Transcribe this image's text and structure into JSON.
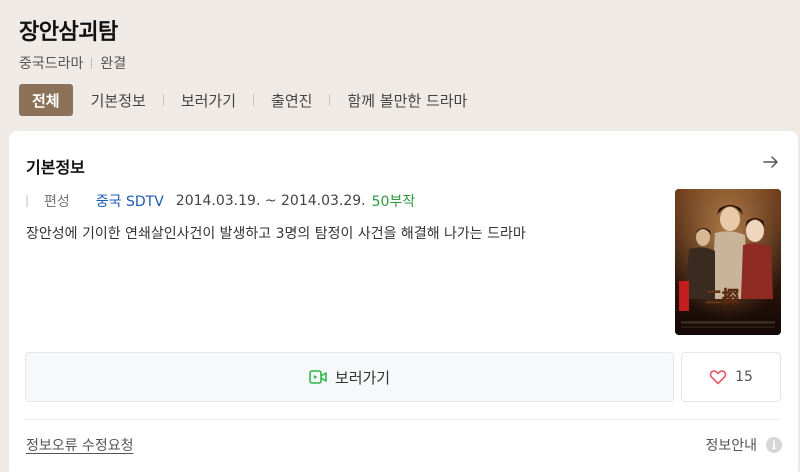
{
  "header": {
    "title": "장안삼괴탐",
    "category": "중국드라마",
    "status": "완결",
    "tabs": [
      {
        "label": "전체",
        "active": true
      },
      {
        "label": "기본정보",
        "active": false
      },
      {
        "label": "보러가기",
        "active": false
      },
      {
        "label": "출연진",
        "active": false
      },
      {
        "label": "함께 볼만한 드라마",
        "active": false
      }
    ]
  },
  "card": {
    "title": "기본정보",
    "arrow_icon": "chevron-right-icon",
    "info": {
      "label": "편성",
      "channel": "중국 SDTV",
      "dates": "2014.03.19. ~ 2014.03.29.",
      "episodes": "50부작"
    },
    "description": "장안성에 기이한 연쇄살인사건이 발생하고 3명의 탐정이 사건을 해결해 나가는 드라마",
    "poster_icon": "drama-poster-image",
    "watch_button": {
      "label": "보러가기",
      "icon": "play-video-icon"
    },
    "like_button": {
      "count": "15",
      "icon": "heart-icon"
    },
    "report_link": "정보오류 수정요청",
    "info_guide": {
      "label": "정보안내",
      "icon": "info-icon"
    },
    "colors": {
      "tab_active_bg": "#8a7158",
      "channel": "#1e5bb5",
      "episodes": "#2c9b3e",
      "heart": "#e05a6b",
      "watch_icon": "#2fb84a"
    }
  }
}
